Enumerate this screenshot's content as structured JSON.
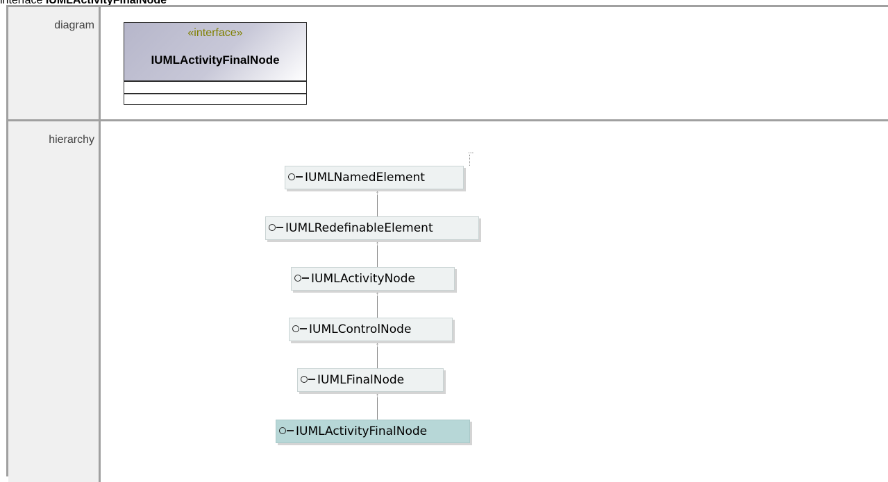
{
  "page_title": {
    "prefix": "interface",
    "name": "IUMLActivityFinalNode"
  },
  "rows": {
    "diagram_label": "diagram",
    "hierarchy_label": "hierarchy"
  },
  "diagram": {
    "stereotype": "«interface»",
    "name": "IUMLActivityFinalNode",
    "header_gradient": [
      "#b6b6ca",
      "#ffffff"
    ]
  },
  "hierarchy": {
    "ellipsis": "...",
    "nodes": [
      {
        "label": "IUMLNamedElement",
        "current": false
      },
      {
        "label": "IUMLRedefinableElement",
        "current": false
      },
      {
        "label": "IUMLActivityNode",
        "current": false
      },
      {
        "label": "IUMLControlNode",
        "current": false
      },
      {
        "label": "IUMLFinalNode",
        "current": false
      },
      {
        "label": "IUMLActivityFinalNode",
        "current": true
      }
    ],
    "node_icon": "interface-lollipop-icon",
    "colors": {
      "node_bg": "#eef2f2",
      "current_bg": "#b7d7d7"
    }
  }
}
